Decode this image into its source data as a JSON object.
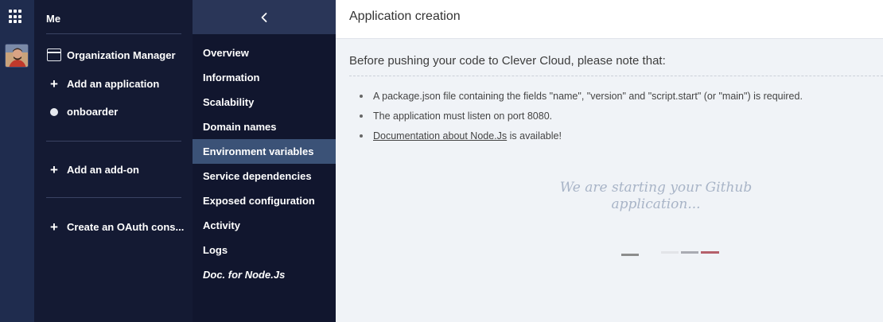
{
  "rail": {
    "apps_icon": "grid-icon",
    "avatar": "user-avatar"
  },
  "org": {
    "me_label": "Me",
    "organization_label": "Organization Manager",
    "add_application_label": "Add an application",
    "app_name": "onboarder",
    "add_addon_label": "Add an add-on",
    "create_oauth_label": "Create an OAuth cons..."
  },
  "nav": {
    "back_icon": "chevron-left-icon",
    "items": [
      {
        "label": "Overview"
      },
      {
        "label": "Information"
      },
      {
        "label": "Scalability"
      },
      {
        "label": "Domain names"
      },
      {
        "label": "Environment variables"
      },
      {
        "label": "Service dependencies"
      },
      {
        "label": "Exposed configuration"
      },
      {
        "label": "Activity"
      },
      {
        "label": "Logs"
      },
      {
        "label": "Doc. for Node.Js"
      }
    ],
    "active_index": 4
  },
  "main": {
    "title": "Application creation",
    "intro": "Before pushing your code to Clever Cloud, please note that:",
    "bullets": [
      "A package.json file containing the fields \"name\", \"version\" and \"script.start\" (or \"main\") is required.",
      "The application must listen on port 8080."
    ],
    "doc_link": "Documentation about Node.Js",
    "doc_suffix": " is available!",
    "starting_text": "We are starting your Github application..."
  },
  "colors": {
    "rail_bg": "#1f2c4e",
    "sidebar_bg": "#141a33",
    "nav_bg": "#11162e",
    "active_bg": "#3b5277",
    "loader_accent": "#b5606b"
  }
}
